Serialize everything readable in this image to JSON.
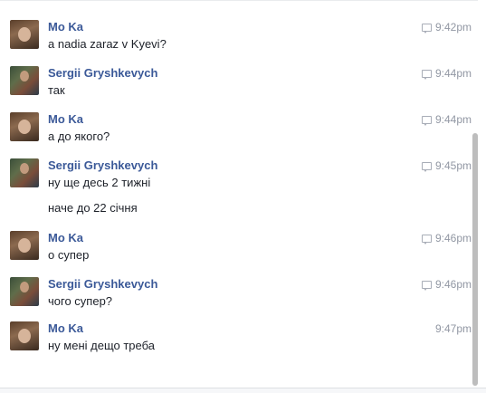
{
  "conversation": {
    "messages": [
      {
        "sender": "Mo Ka",
        "avatar": "moka",
        "time": "9:42pm",
        "seen": true,
        "lines": [
          "a nadia zaraz v Kyevi?"
        ]
      },
      {
        "sender": "Sergii Gryshkevych",
        "avatar": "sergii",
        "time": "9:44pm",
        "seen": true,
        "lines": [
          "так"
        ]
      },
      {
        "sender": "Mo Ka",
        "avatar": "moka",
        "time": "9:44pm",
        "seen": true,
        "lines": [
          "а до якого?"
        ]
      },
      {
        "sender": "Sergii Gryshkevych",
        "avatar": "sergii",
        "time": "9:45pm",
        "seen": true,
        "lines": [
          "ну ще десь 2 тижні",
          "наче до 22 січня"
        ]
      },
      {
        "sender": "Mo Ka",
        "avatar": "moka",
        "time": "9:46pm",
        "seen": true,
        "lines": [
          "о супер"
        ]
      },
      {
        "sender": "Sergii Gryshkevych",
        "avatar": "sergii",
        "time": "9:46pm",
        "seen": true,
        "lines": [
          "чого супер?"
        ]
      },
      {
        "sender": "Mo Ka",
        "avatar": "moka",
        "time": "9:47pm",
        "seen": false,
        "lines": [
          "ну мені дещо треба"
        ]
      }
    ]
  },
  "icons": {
    "seen": "seen-check-icon",
    "avatar_moka": "avatar-mo-ka",
    "avatar_sergii": "avatar-sergii-gryshkevych"
  },
  "colors": {
    "sender_name": "#3b5998",
    "message_text": "#1d2129",
    "timestamp": "#9197a3",
    "scrollbar_thumb": "#bdbdbd"
  }
}
